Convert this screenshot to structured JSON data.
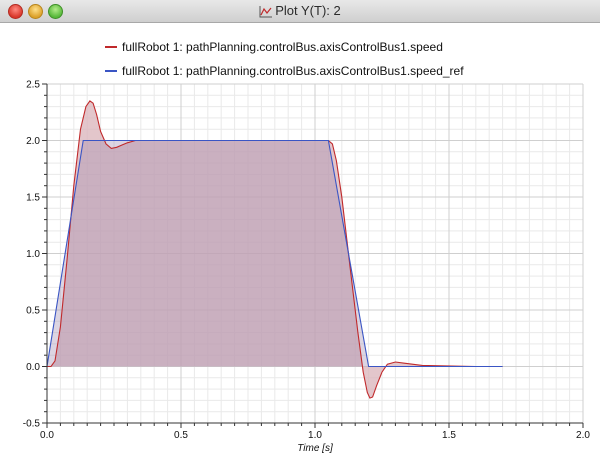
{
  "window": {
    "title": "Plot Y(T): 2",
    "title_icon": "line-plot-icon"
  },
  "legend": {
    "items": [
      {
        "label": "fullRobot 1: pathPlanning.controlBus.axisControlBus1.speed",
        "color": "#c0292b"
      },
      {
        "label": "fullRobot 1: pathPlanning.controlBus.axisControlBus1.speed_ref",
        "color": "#3a55c4"
      }
    ]
  },
  "chart_data": {
    "type": "line",
    "title": "",
    "xlabel": "Time [s]",
    "ylabel": "",
    "xlim": [
      0,
      2.0
    ],
    "ylim": [
      -0.5,
      2.5
    ],
    "xticks": [
      "0.0",
      "0.5",
      "1.0",
      "1.5",
      "2.0"
    ],
    "yticks": [
      "-0.5",
      "0.0",
      "0.5",
      "1.0",
      "1.5",
      "2.0",
      "2.5"
    ],
    "grid": true,
    "legend_position": "top",
    "series": [
      {
        "name": "fullRobot 1: pathPlanning.controlBus.axisControlBus1.speed",
        "color": "#c0292b",
        "fill": "#d9b3b9",
        "x": [
          0,
          0.015,
          0.03,
          0.05,
          0.075,
          0.1,
          0.125,
          0.145,
          0.16,
          0.172,
          0.185,
          0.2,
          0.22,
          0.24,
          0.26,
          0.28,
          0.3,
          0.33,
          0.36,
          0.4,
          0.7,
          1.0,
          1.05,
          1.065,
          1.08,
          1.1,
          1.13,
          1.16,
          1.18,
          1.195,
          1.205,
          1.215,
          1.23,
          1.25,
          1.27,
          1.3,
          1.33,
          1.4,
          1.6,
          1.7
        ],
        "y": [
          0,
          0.0,
          0.05,
          0.35,
          0.95,
          1.6,
          2.1,
          2.3,
          2.35,
          2.33,
          2.23,
          2.08,
          1.97,
          1.93,
          1.94,
          1.96,
          1.98,
          2.0,
          2.0,
          2.0,
          2.0,
          2.0,
          2.0,
          1.97,
          1.82,
          1.5,
          0.9,
          0.3,
          -0.05,
          -0.23,
          -0.28,
          -0.27,
          -0.17,
          -0.05,
          0.02,
          0.04,
          0.03,
          0.01,
          0.0,
          0.0
        ]
      },
      {
        "name": "fullRobot 1: pathPlanning.controlBus.axisControlBus1.speed_ref",
        "color": "#3a55c4",
        "fill": "",
        "x": [
          0,
          0.135,
          0.16,
          1.0,
          1.05,
          1.2,
          1.24,
          1.7
        ],
        "y": [
          0,
          2.0,
          2.0,
          2.0,
          2.0,
          0.0,
          0.0,
          0.0
        ]
      }
    ]
  }
}
